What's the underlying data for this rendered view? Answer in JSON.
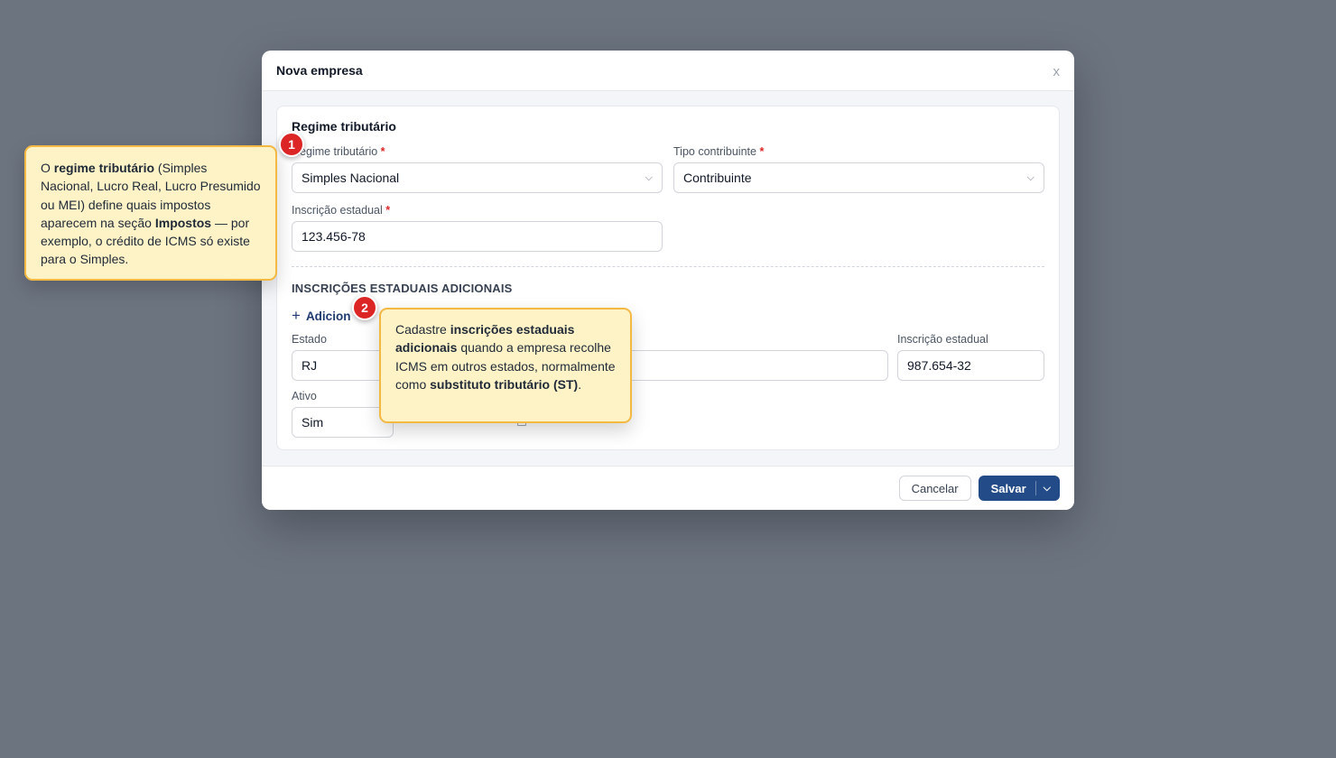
{
  "modal": {
    "title": "Nova empresa",
    "close_label": "x"
  },
  "section": {
    "title": "Regime tributário",
    "regime": {
      "label": "Regime tributário",
      "required_mark": "*",
      "value": "Simples Nacional"
    },
    "tipo": {
      "label": "Tipo contribuinte",
      "required_mark": "*",
      "value": "Contribuinte"
    },
    "ie": {
      "label": "Inscrição estadual",
      "required_mark": "*",
      "value": "123.456-78"
    }
  },
  "additional": {
    "heading": "INSCRIÇÕES ESTADUAIS ADICIONAIS",
    "add_label": "Adicion",
    "estado_label": "Estado",
    "estado_value": "RJ",
    "ie_label": "Inscrição estadual",
    "ie_value": "987.654-32",
    "ativo_label": "Ativo",
    "ativo_value": "Sim"
  },
  "footer": {
    "cancel_label": "Cancelar",
    "save_label": "Salvar"
  },
  "tips": {
    "one": {
      "number": "1",
      "t1": "O ",
      "b1": "regime tributário",
      "t2": " (Simples Nacional, Lucro Real, Lucro Presumido ou MEI) define quais impostos aparecem na seção ",
      "b2": "Impostos",
      "t3": " — por exemplo, o crédito de ICMS só existe para o Simples."
    },
    "two": {
      "number": "2",
      "t1": "Cadastre ",
      "b1": "inscrições estaduais adicionais",
      "t2": " quando a empresa recolhe ICMS em outros estados, normalmente como ",
      "b2": "substituto tributário (ST)",
      "t3": "."
    }
  },
  "icons": {
    "chevron": "chevron-down-icon",
    "plus": "plus-icon",
    "trash": "trash-icon"
  },
  "colors": {
    "primary": "#234b87",
    "required": "#dc2626",
    "tip_bg": "#fef3c7",
    "tip_border": "#f4b942",
    "badge": "#dc2626"
  }
}
